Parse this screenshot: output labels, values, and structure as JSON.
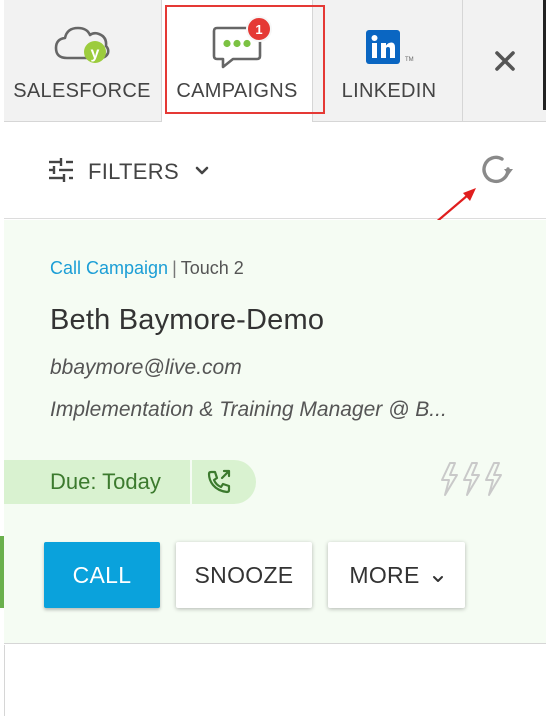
{
  "tabs": [
    {
      "label": "SALESFORCE",
      "icon": "salesforce-cloud-icon"
    },
    {
      "label": "CAMPAIGNS",
      "icon": "chat-bubble-icon",
      "badge": "1",
      "active": true
    },
    {
      "label": "LINKEDIN",
      "icon": "linkedin-icon"
    }
  ],
  "close_icon": "close-icon",
  "filters": {
    "label": "FILTERS",
    "icon": "sliders-icon"
  },
  "refresh_icon": "refresh-icon",
  "card": {
    "campaign_type": "Call Campaign",
    "separator": "|",
    "touch": "Touch 2",
    "name": "Beth Baymore-Demo",
    "email": "bbaymore@live.com",
    "title": "Implementation & Training Manager @ B...",
    "due": "Due: Today",
    "buttons": {
      "call": "CALL",
      "snooze": "SNOOZE",
      "more": "MORE"
    }
  },
  "colors": {
    "accent_blue": "#0aa2dc",
    "campaign_link": "#1b9ed6",
    "badge_red": "#e53935",
    "due_green_bg": "#d9f2d0",
    "due_green_text": "#3c7a2e",
    "card_bg": "#f5fcf3",
    "annotation_red": "#e01e1e"
  }
}
